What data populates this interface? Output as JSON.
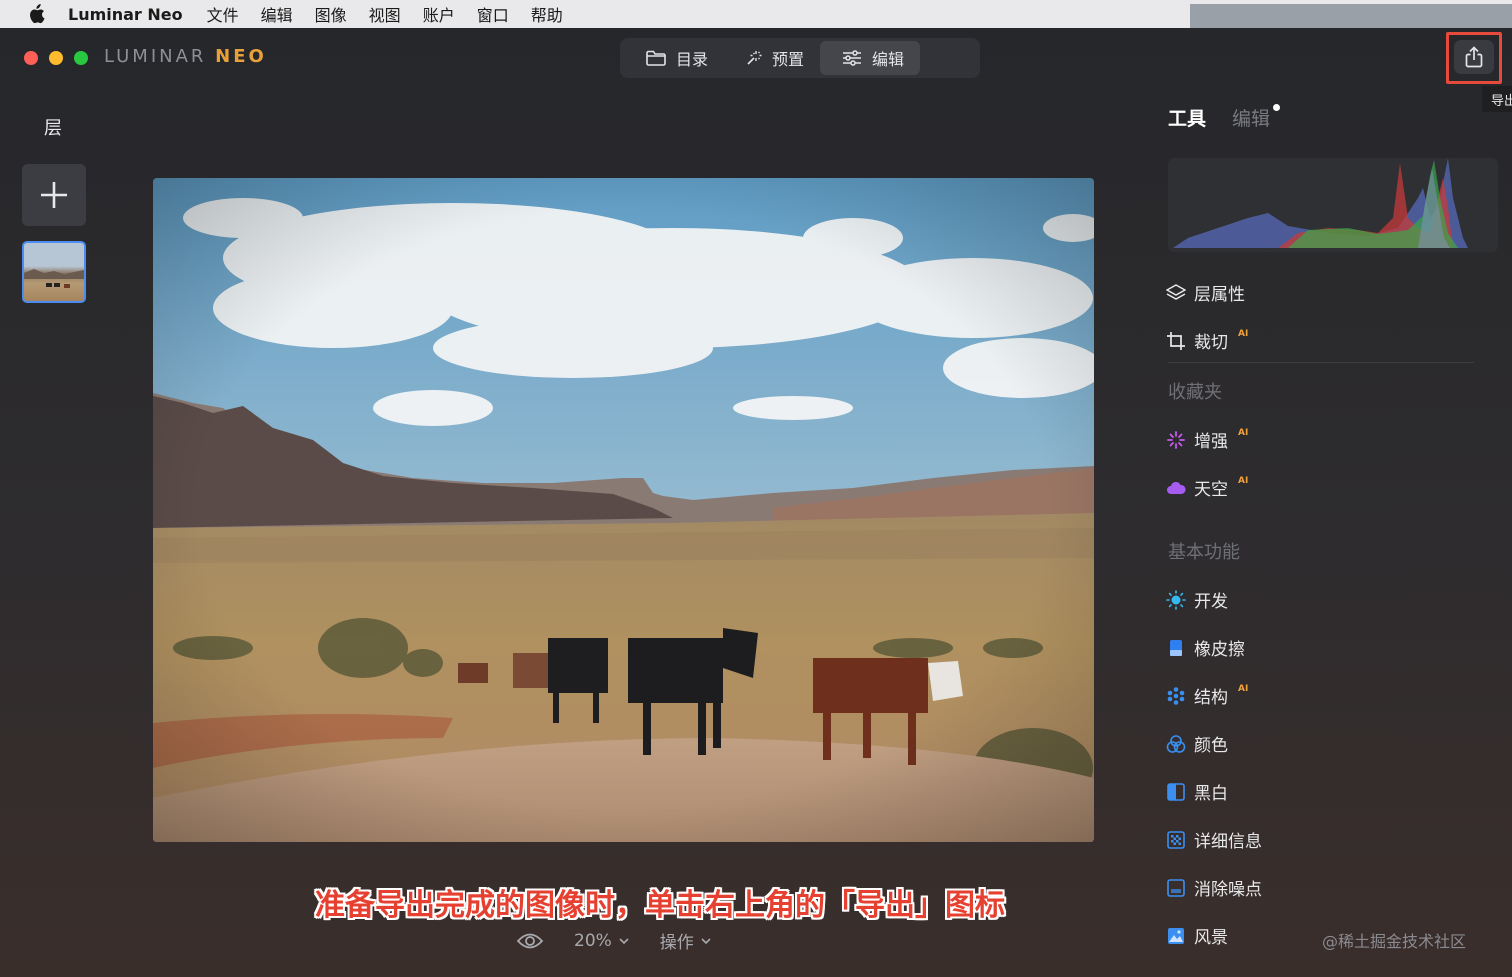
{
  "menubar": {
    "app_name": "Luminar Neo",
    "items": [
      "文件",
      "编辑",
      "图像",
      "视图",
      "账户",
      "窗口",
      "帮助"
    ]
  },
  "window": {
    "logo_main": "LUMINAR",
    "logo_accent": "NEO"
  },
  "topnav": {
    "catalog": "目录",
    "presets": "预置",
    "edit": "编辑",
    "active": "edit"
  },
  "export": {
    "tooltip": "导出"
  },
  "layers": {
    "title": "层"
  },
  "caption": "准备导出完成的图像时，单击右上角的「导出」图标",
  "bottombar": {
    "zoom": "20%",
    "actions": "操作"
  },
  "right_panel": {
    "tab_tools": "工具",
    "tab_edits": "编辑",
    "tools": [
      {
        "label": "层属性",
        "icon": "layers-icon",
        "ai": ""
      },
      {
        "label": "裁切",
        "icon": "crop-icon",
        "ai": "AI"
      }
    ],
    "favorites_title": "收藏夹",
    "favorites": [
      {
        "label": "增强",
        "icon": "sparkle-icon",
        "ai": "AI"
      },
      {
        "label": "天空",
        "icon": "cloud-icon",
        "ai": "AI"
      }
    ],
    "essentials_title": "基本功能",
    "essentials": [
      {
        "label": "开发",
        "icon": "sun-icon",
        "ai": ""
      },
      {
        "label": "橡皮擦",
        "icon": "eraser-icon",
        "ai": ""
      },
      {
        "label": "结构",
        "icon": "structure-icon",
        "ai": "AI"
      },
      {
        "label": "颜色",
        "icon": "color-icon",
        "ai": ""
      },
      {
        "label": "黑白",
        "icon": "bw-icon",
        "ai": ""
      },
      {
        "label": "详细信息",
        "icon": "details-icon",
        "ai": ""
      },
      {
        "label": "消除噪点",
        "icon": "denoise-icon",
        "ai": ""
      },
      {
        "label": "风景",
        "icon": "landscape-icon",
        "ai": ""
      }
    ]
  },
  "watermark": "@稀土掘金技术社区",
  "colors": {
    "accent_red": "#e64a3c",
    "neo_orange": "#e8a13a",
    "selection_blue": "#4a8cf0"
  }
}
